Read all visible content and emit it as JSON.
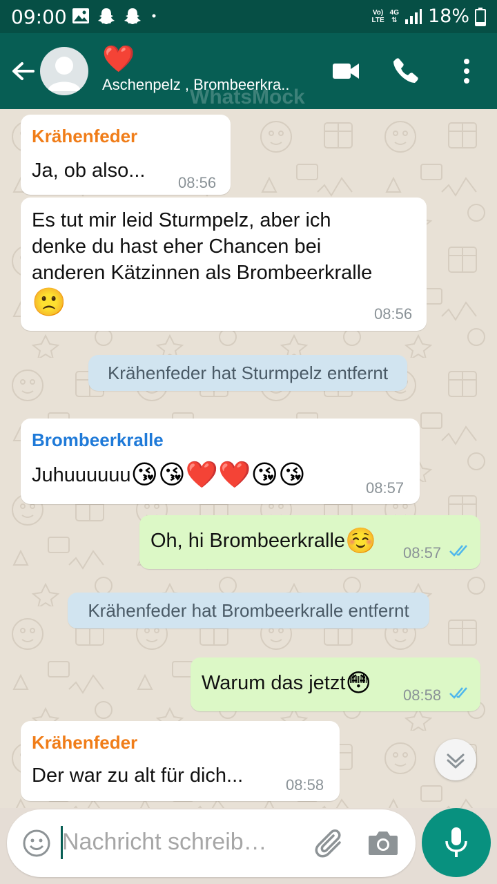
{
  "status_bar": {
    "time": "09:00",
    "network_top": "Vo)",
    "network_bottom": "LTE",
    "signal_type": "4G",
    "battery": "18%"
  },
  "header": {
    "group_emoji": "❤️",
    "members": "Aschenpelz , Brombeerkra..",
    "watermark": "WhatsMock",
    "icons": [
      "back-arrow-icon",
      "video-call-icon",
      "phone-icon",
      "more-options-icon"
    ]
  },
  "messages": [
    {
      "type": "in",
      "sender": "Krähenfeder",
      "sender_color": "#f07d19",
      "text": "Ja, ob also...",
      "time": "08:56"
    },
    {
      "type": "in",
      "text_lines": [
        "Es tut mir leid Sturmpelz, aber ich",
        "denke du hast eher Chancen bei",
        "anderen Kätzinnen als Brombeerkralle"
      ],
      "emoji": "🙁",
      "time": "08:56"
    },
    {
      "type": "system",
      "text": "Krähenfeder hat Sturmpelz entfernt"
    },
    {
      "type": "in",
      "sender": "Brombeerkralle",
      "sender_color": "#1f7ad8",
      "text": "Juhuuuuuu",
      "emojis": [
        "😘",
        "😘",
        "❤️",
        "❤️",
        "😘",
        "😘"
      ],
      "time": "08:57"
    },
    {
      "type": "out",
      "text": "Oh, hi Brombeerkralle",
      "emoji": "☺️",
      "time": "08:57",
      "status": "read"
    },
    {
      "type": "system",
      "text": "Krähenfeder hat Brombeerkralle entfernt"
    },
    {
      "type": "out",
      "text": "Warum das jetzt",
      "emoji": "😳",
      "time": "08:58",
      "status": "read"
    },
    {
      "type": "in",
      "sender": "Krähenfeder",
      "sender_color": "#f07d19",
      "text": "Der war zu alt für dich...",
      "time": "08:58"
    }
  ],
  "input": {
    "placeholder": "Nachricht schreib…"
  },
  "colors": {
    "header": "#075e54",
    "status_bar": "#064f45",
    "outgoing_bubble": "#dcf8c6",
    "system_bubble": "#d1e4f0",
    "read_ticks": "#4fb7ec",
    "mic_button": "#08917f"
  }
}
